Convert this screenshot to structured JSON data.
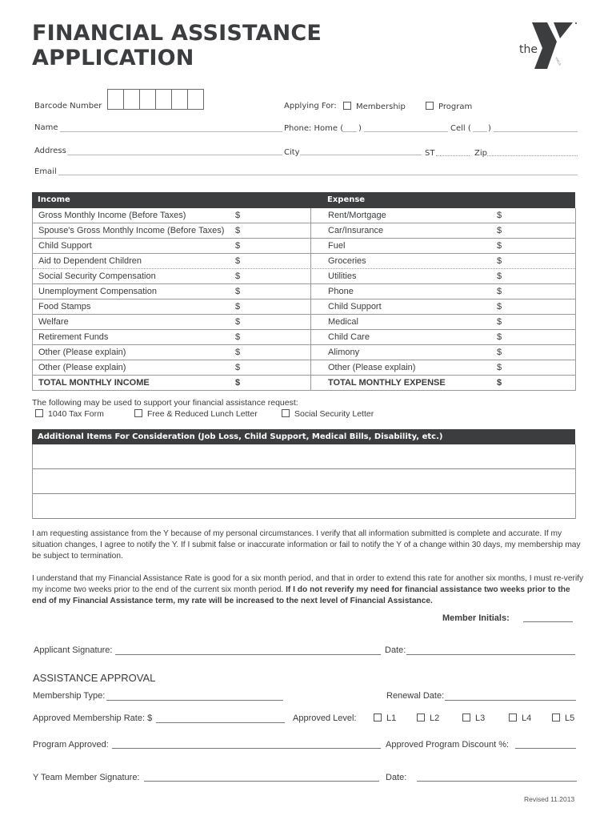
{
  "header": {
    "title_line1": "FINANCIAL ASSISTANCE",
    "title_line2": "APPLICATION",
    "logo_text": "the",
    "logo_small": "YMCA"
  },
  "applicant": {
    "barcode_label": "Barcode Number",
    "applying_for_label": "Applying For:",
    "applying_options": [
      "Membership",
      "Program"
    ],
    "name_label": "Name",
    "phone_home_label": "Phone: Home (",
    "phone_close": ")",
    "cell_label": "Cell (",
    "address_label": "Address",
    "city_label": "City",
    "st_label": "ST",
    "zip_label": "Zip",
    "email_label": "Email"
  },
  "finances": {
    "income_header": "Income",
    "expense_header": "Expense",
    "currency": "$",
    "income_items": [
      "Gross Monthly Income (Before Taxes)",
      "Spouse's Gross Monthly Income (Before Taxes)",
      "Child Support",
      "Aid to Dependent Children",
      "Social Security Compensation",
      "Unemployment Compensation",
      "Food Stamps",
      "Welfare",
      "Retirement Funds",
      "Other (Please explain)",
      "Other (Please explain)",
      "TOTAL MONTHLY INCOME"
    ],
    "expense_items": [
      "Rent/Mortgage",
      "Car/Insurance",
      "Fuel",
      "Groceries",
      "Utilities",
      "Phone",
      "Child Support",
      "Medical",
      "Child Care",
      "Alimony",
      "Other (Please explain)",
      "TOTAL MONTHLY EXPENSE"
    ]
  },
  "supporting": {
    "intro": "The following may be used to support your financial assistance request:",
    "options": [
      "1040 Tax Form",
      "Free & Reduced Lunch Letter",
      "Social Security Letter"
    ]
  },
  "additional": {
    "header": "Additional Items For Consideration (Job Loss, Child Support, Medical Bills, Disability, etc.)"
  },
  "agreement": {
    "para1": "I am requesting assistance from the Y because of my personal circumstances. I verify that all information submitted is complete and accurate. If my situation changes, I agree to notify the Y. If I submit false or inaccurate information or fail to notify the Y of a change within 30 days, my membership may be subject to termination.",
    "para2_normal": "I understand that my Financial Assistance Rate is good for a six month period, and that in order to extend this rate for another six months, I must re-verify my income two weeks prior to the end of the current six month period. ",
    "para2_bold": "If I do not reverify my need for financial assistance two weeks prior to the end of my Financial Assistance term, my rate will be increased to the next level of Financial Assistance.",
    "initials_label": "Member Initials:",
    "applicant_signature_label": "Applicant Signature:",
    "date_label": "Date:"
  },
  "approval": {
    "heading": "ASSISTANCE APPROVAL",
    "membership_type_label": "Membership Type:",
    "renewal_date_label": "Renewal Date:",
    "approved_rate_label": "Approved Membership Rate: $",
    "approved_level_label": "Approved Level:",
    "levels": [
      "L1",
      "L2",
      "L3",
      "L4",
      "L5"
    ],
    "program_approved_label": "Program Approved:",
    "program_discount_label": "Approved Program Discount %:",
    "team_signature_label": "Y Team Member Signature:",
    "date_label": "Date:"
  },
  "footer": {
    "revised": "Revised 11.2013"
  }
}
